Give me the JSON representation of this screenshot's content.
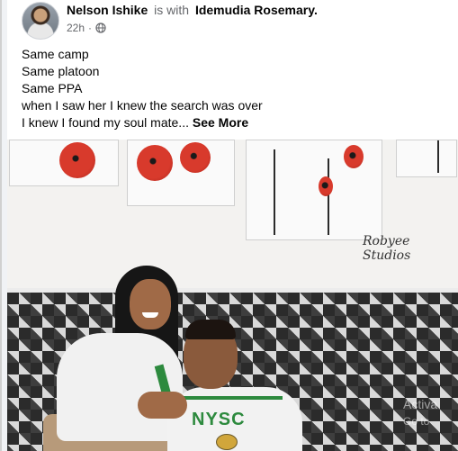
{
  "post": {
    "author": "Nelson Ishike",
    "with_text": "is with",
    "tagged": "Idemudia Rosemary.",
    "time": "22h",
    "privacy_icon": "globe-icon",
    "lines": [
      "Same camp",
      "Same platoon",
      "Same PPA",
      "when I saw her I knew the search was over",
      "I knew I found my soul mate..."
    ],
    "see_more": "See More"
  },
  "photo": {
    "watermark": "Robyee Studios",
    "shirt_text": "NYSC",
    "overlay_line1": "Activa",
    "overlay_line2": "Go to"
  },
  "colors": {
    "nysc_green": "#2d8a3e",
    "poppy_red": "#d83a2c",
    "text": "#050505",
    "meta": "#65676b"
  }
}
